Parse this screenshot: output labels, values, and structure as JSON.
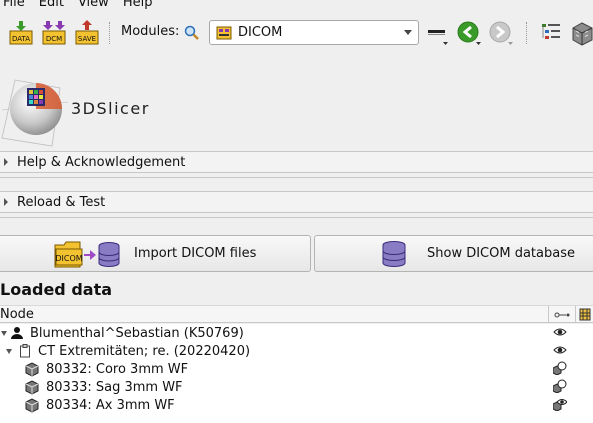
{
  "menubar": {
    "items": [
      "File",
      "Edit",
      "View",
      "Help"
    ]
  },
  "toolbar": {
    "data_button_label": "DATA",
    "dcm_button_label": "DCM",
    "save_button_label": "SAVE",
    "modules_label": "Modules:",
    "module_selected": "DICOM"
  },
  "logo": {
    "text": "3DSlicer"
  },
  "panels": {
    "help": "Help & Acknowledgement",
    "reload": "Reload & Test"
  },
  "buttons": {
    "import": "Import DICOM files",
    "import_icon_text": "DICOM",
    "show_db": "Show DICOM database"
  },
  "loaded": {
    "title": "Loaded data",
    "column_node": "Node",
    "rows": [
      {
        "label": "Blumenthal^Sebastian (K50769)"
      },
      {
        "label": "CT Extremitäten; re. (20220420)"
      },
      {
        "label": "80332: Coro 3mm WF"
      },
      {
        "label": "80333: Sag 3mm WF"
      },
      {
        "label": "80334: Ax 3mm WF"
      }
    ]
  },
  "colors": {
    "accent_green": "#3a9a2a",
    "dicom_yellow": "#f2c230",
    "db_purple": "#8a7cc4"
  }
}
